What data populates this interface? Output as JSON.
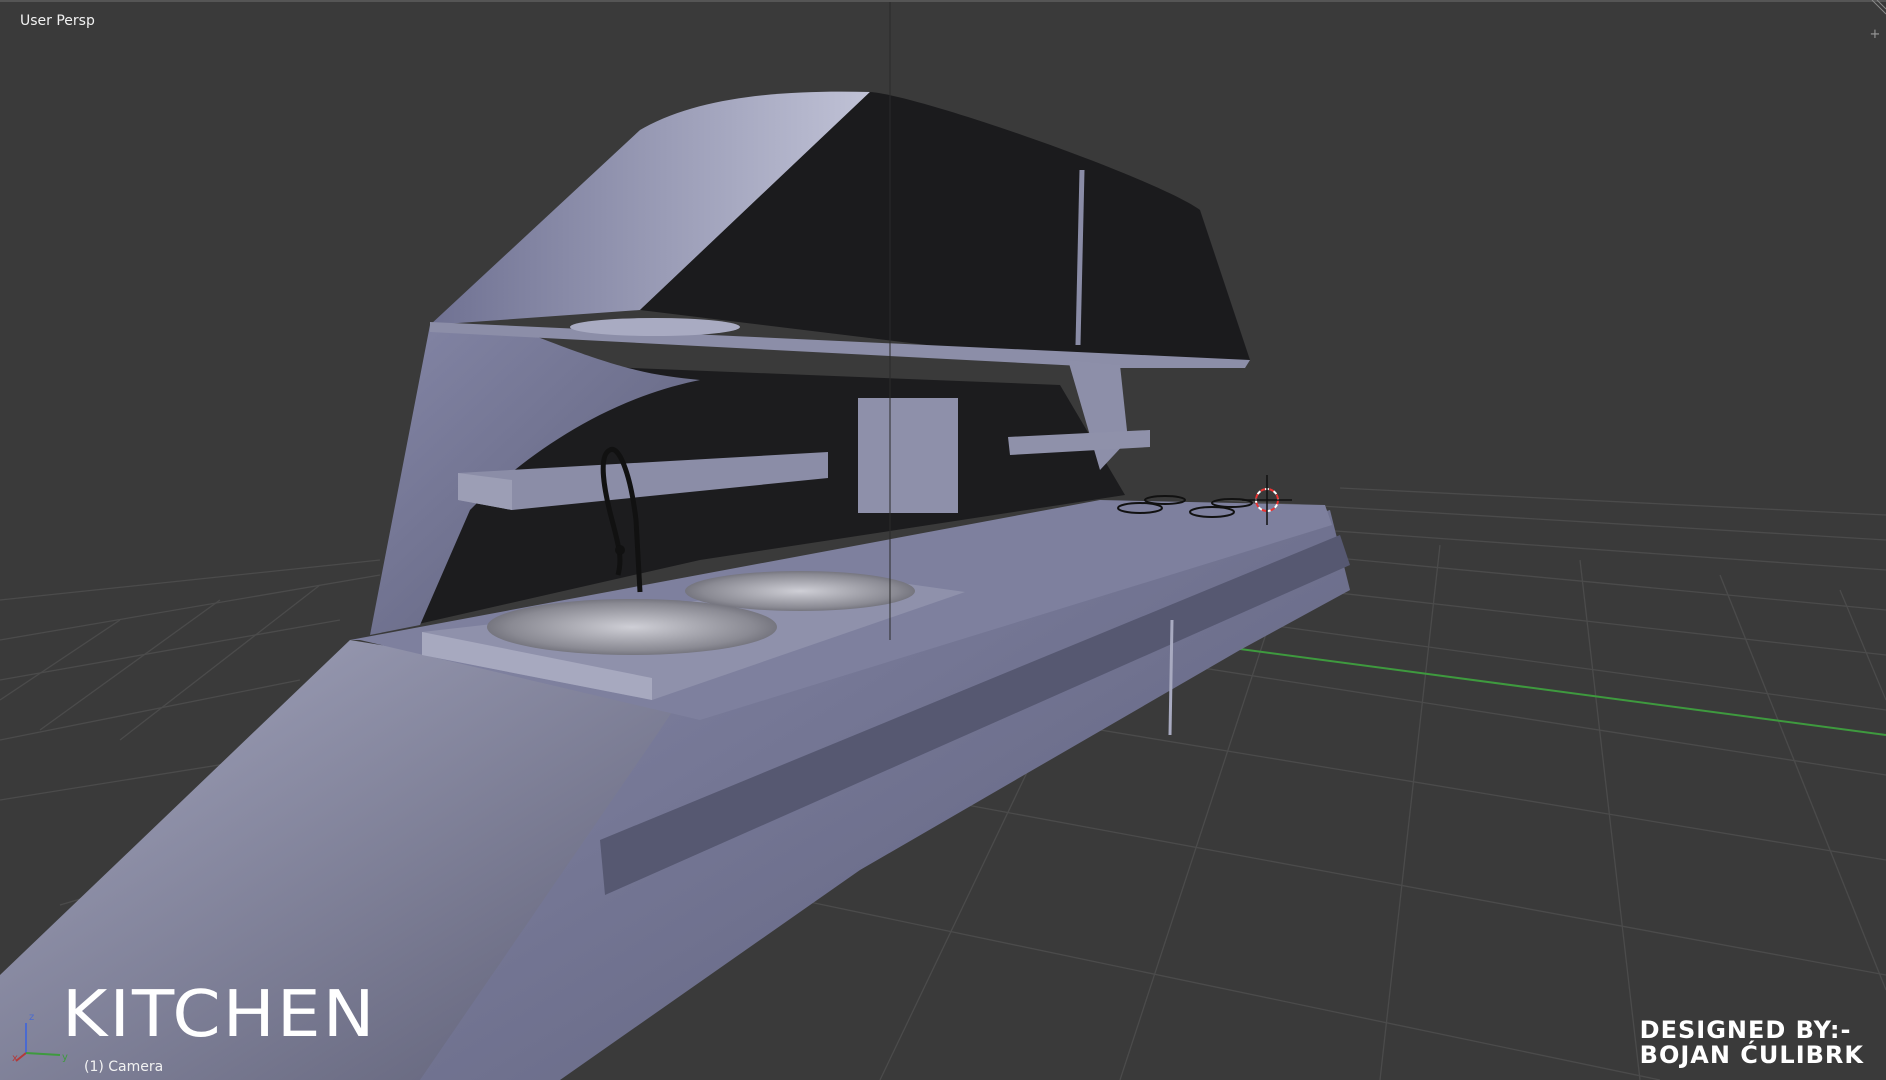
{
  "viewport": {
    "view_label": "User Persp",
    "object_label": "(1) Camera",
    "title_overlay": "KITCHEN",
    "credits": {
      "line1": "DESIGNED BY:-",
      "line2": "BOJAN ĆULIBRK"
    },
    "corner_button_icon": "plus-icon",
    "axis_labels": {
      "x": "x",
      "y": "y",
      "z": "z"
    },
    "colors": {
      "background": "#3a3a3a",
      "grid": "#4a4a4a",
      "x_axis": "#b33a3a",
      "y_axis": "#3e9a3e",
      "z_axis": "#4a6ad0",
      "mesh_light": "#8f91b0",
      "mesh_dark": "#1b1b1d"
    }
  }
}
